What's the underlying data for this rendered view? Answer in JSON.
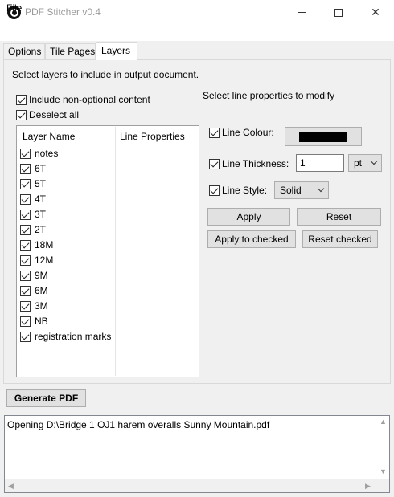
{
  "window": {
    "title": "PDF Stitcher v0.4"
  },
  "menu": {
    "file": "File"
  },
  "tabs": [
    "Options",
    "Tile Pages",
    "Layers"
  ],
  "layers_tab": {
    "instruction": "Select layers to include in output document.",
    "include_non_optional": "Include non-optional content",
    "deselect_all": "Deselect all",
    "columns": [
      "Layer Name",
      "Line Properties"
    ],
    "layers": [
      "notes",
      "6T",
      "5T",
      "4T",
      "3T",
      "2T",
      "18M",
      "12M",
      "9M",
      "6M",
      "3M",
      "NB",
      "registration marks"
    ],
    "line_props_heading": "Select line properties to modify",
    "line_colour_label": "Line Colour:",
    "line_colour_value": "#000000",
    "line_thickness_label": "Line Thickness:",
    "line_thickness_value": "1",
    "unit_value": "pt",
    "line_style_label": "Line Style:",
    "line_style_value": "Solid",
    "apply": "Apply",
    "reset": "Reset",
    "apply_checked": "Apply to checked",
    "reset_checked": "Reset checked"
  },
  "generate": "Generate PDF",
  "log": "Opening D:\\Bridge 1 OJ1 harem overalls Sunny Mountain.pdf"
}
